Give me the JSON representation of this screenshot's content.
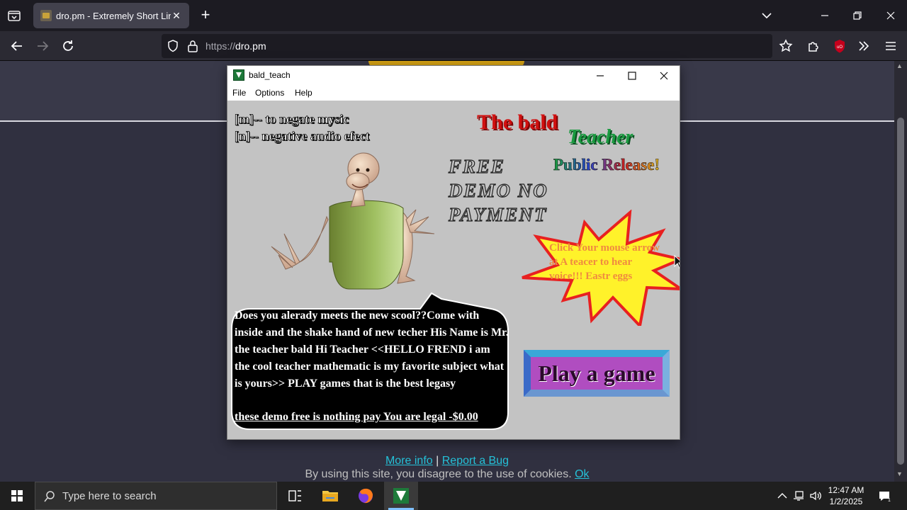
{
  "browser": {
    "tab_title": "dro.pm - Extremely Short Links",
    "url_scheme": "https://",
    "url_host": "dro.pm"
  },
  "page": {
    "footer_more_info": "More info",
    "footer_separator": "|",
    "footer_report_bug": "Report a Bug",
    "cookie_text": "By using this site, you disagree to the use of cookies.",
    "cookie_ok": "Ok"
  },
  "app": {
    "title": "bald_teach",
    "menu": [
      "File",
      "Options",
      "Help"
    ],
    "hint_m": "[m]-- to negate mysic",
    "hint_n": "[n]-- negative audio efect",
    "title_bald": "The bald",
    "title_teacher": "Teacher",
    "public_release": "Public Release!",
    "free_demo": [
      "FREE",
      "DEMO NO",
      "PAYMENT"
    ],
    "star_text": "Click Your mouse arrow at A teacer to hear voice!!! Eastr eggs",
    "speech_lines": [
      "Does you alerady meets the new scool??Come with",
      "inside and the shake hand of new techer His Name is Mr.",
      "the teacher bald Hi Teacher <<HELLO FREND i am",
      "the cool teacher mathematic is my favorite subject what",
      "is yours>> PLAY games that is the best legasy"
    ],
    "speech_footer": "these demo free is nothing pay You are legal -$0.00",
    "play_label": "Play a game"
  },
  "taskbar": {
    "search_placeholder": "Type here to search",
    "time": "12:47 AM",
    "date": "1/2/2025"
  },
  "colors": {
    "accent_link": "#25c1d8",
    "title_red": "#d01010",
    "title_green": "#1a9a40",
    "star_yellow": "#fff22a",
    "star_red": "#e82020",
    "play_purple": "#b04dc0"
  }
}
